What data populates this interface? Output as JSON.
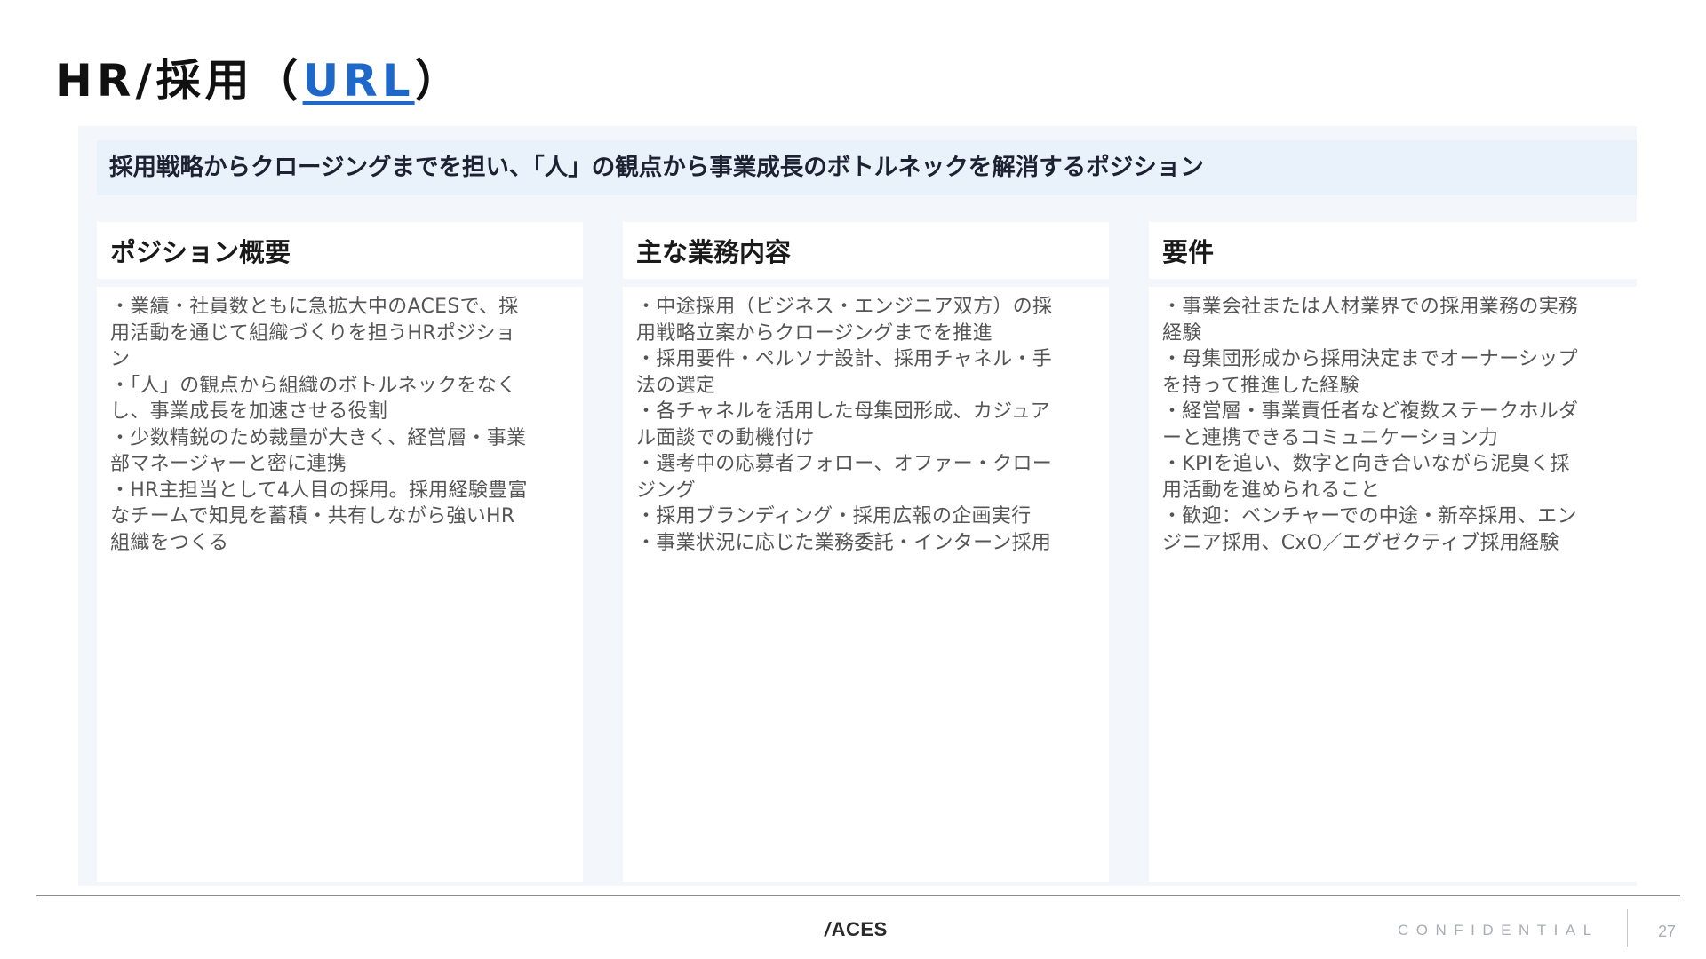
{
  "header": {
    "title_prefix": "HR/採用（",
    "title_link": "URL",
    "title_suffix": "）"
  },
  "lead": "採用戦略からクロージングまでを担い、「人」の観点から事業成長のボトルネックを解消するポジション",
  "columns": [
    {
      "heading": "ポジション概要",
      "lines": [
        "・業績・社員数ともに急拡大中のACESで、採",
        "用活動を通じて組織づくりを担うHRポジショ",
        "ン",
        "・「人」の観点から組織のボトルネックをなく",
        "し、事業成長を加速させる役割",
        "・少数精鋭のため裁量が大きく、経営層・事業",
        "部マネージャーと密に連携",
        "・HR主担当として4人目の採用。採用経験豊富",
        "なチームで知見を蓄積・共有しながら強いHR",
        "組織をつくる"
      ]
    },
    {
      "heading": "主な業務内容",
      "lines": [
        "・中途採用（ビジネス・エンジニア双方）の採",
        "用戦略立案からクロージングまでを推進",
        "・採用要件・ペルソナ設計、採用チャネル・手",
        "法の選定",
        "・各チャネルを活用した母集団形成、カジュア",
        "ル面談での動機付け",
        "・選考中の応募者フォロー、オファー・クロー",
        "ジング",
        "・採用ブランディング・採用広報の企画実行",
        "・事業状況に応じた業務委託・インターン採用"
      ]
    },
    {
      "heading": "要件",
      "lines": [
        "・事業会社または人材業界での採用業務の実務",
        "経験",
        "・母集団形成から採用決定までオーナーシップ",
        "を持って推進した経験",
        "・経営層・事業責任者など複数ステークホルダ",
        "ーと連携できるコミュニケーション力",
        "・KPIを追い、数字と向き合いながら泥臭く採",
        "用活動を進められること",
        "・歓迎：ベンチャーでの中途・新卒採用、エン",
        "ジニア採用、CxO／エグゼクティブ採用経験"
      ]
    }
  ],
  "footer": {
    "logo_slash": "/",
    "logo_text": "ACES",
    "confidential": "CONFIDENTIAL",
    "page_number": "27"
  }
}
